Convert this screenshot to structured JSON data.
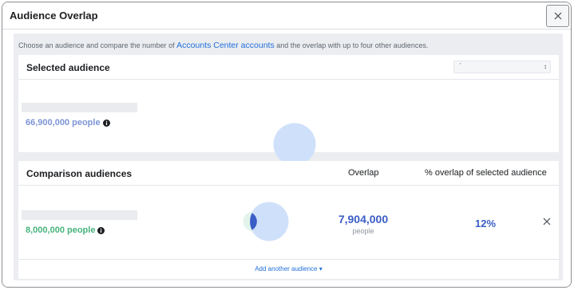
{
  "dialog": {
    "title": "Audience Overlap",
    "close_icon": "close-icon"
  },
  "intro": {
    "text_before": "Choose an audience and compare the number of ",
    "link": "Accounts Center accounts",
    "text_after": " and the overlap with up to four other audiences."
  },
  "selected": {
    "heading": "Selected audience",
    "dropdown_value": "'",
    "people": "66,900,000 people",
    "color": "#7d95d6"
  },
  "comparison": {
    "heading": "Comparison audiences",
    "col_overlap": "Overlap",
    "col_pct": "% overlap of selected audience",
    "rows": [
      {
        "people": "8,000,000 people",
        "color": "#45b37c",
        "overlap_value": "7,904,000",
        "overlap_unit": "people",
        "pct": "12%"
      }
    ],
    "add_label": "Add another audience"
  },
  "colors": {
    "link": "#216fdb",
    "accent": "#3b5ec6",
    "circle_selected": "#cfe0fa",
    "circle_compare": "#e3f4ec",
    "overlap_fill": "#3b5ec6"
  }
}
